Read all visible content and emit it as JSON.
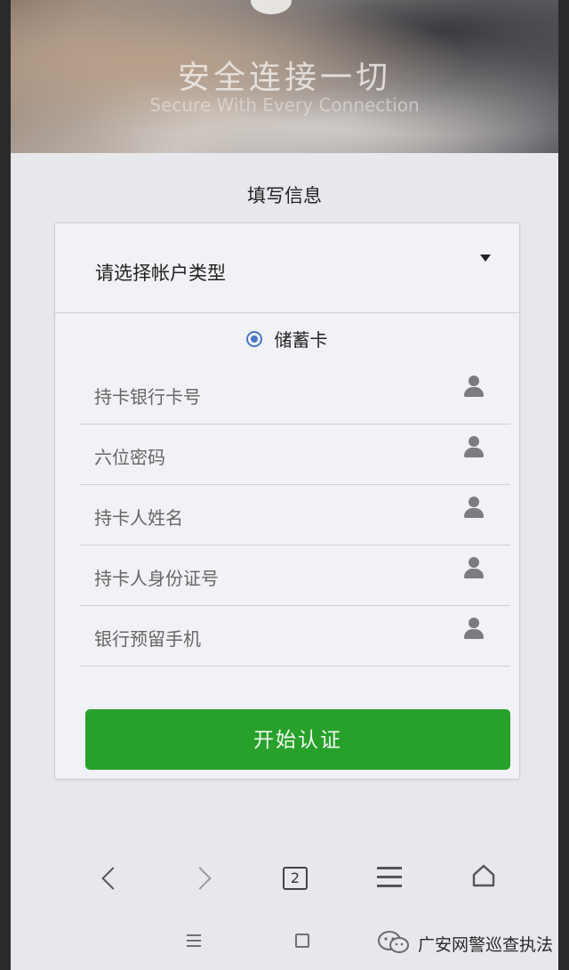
{
  "hero": {
    "title": "安全连接一切",
    "subtitle": "Secure With Every Connection"
  },
  "form": {
    "title": "填写信息",
    "account_type_placeholder": "请选择帐户类型",
    "card_type_option": "储蓄卡",
    "card_type_selected": true,
    "fields": [
      {
        "label": "持卡银行卡号",
        "icon": "person-icon"
      },
      {
        "label": "六位密码",
        "icon": "person-icon"
      },
      {
        "label": "持卡人姓名",
        "icon": "person-icon"
      },
      {
        "label": "持卡人身份证号",
        "icon": "person-icon"
      },
      {
        "label": "银行预留手机",
        "icon": "person-icon"
      }
    ],
    "submit_label": "开始认证",
    "submit_color": "#27a12a"
  },
  "toolbar": {
    "back_icon": "chevron-left-icon",
    "forward_icon": "chevron-right-icon",
    "tab_count": "2",
    "menu_icon": "menu-icon",
    "home_icon": "home-icon"
  },
  "watermark": {
    "text": "广安网警巡查执法",
    "icon": "wechat-icon"
  }
}
